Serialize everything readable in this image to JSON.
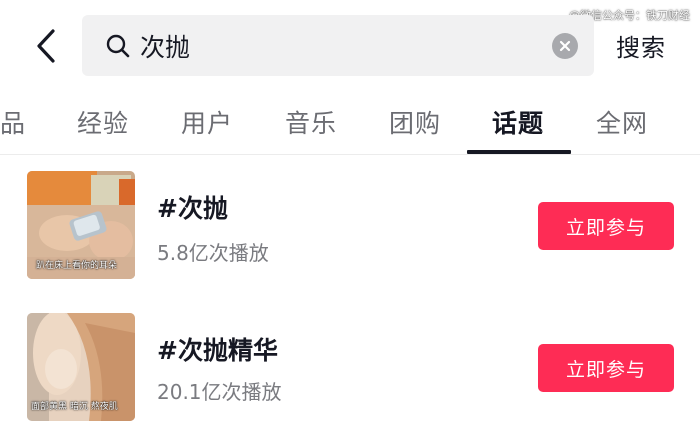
{
  "watermark": "@微信公众号：铁刀财经",
  "search": {
    "query": "次抛",
    "action_label": "搜索"
  },
  "tabs": [
    {
      "label": "品"
    },
    {
      "label": "经验"
    },
    {
      "label": "用户"
    },
    {
      "label": "音乐"
    },
    {
      "label": "团购"
    },
    {
      "label": "话题",
      "active": true
    },
    {
      "label": "全网"
    }
  ],
  "topics": [
    {
      "name": "#次抛",
      "plays": "5.8亿次播放",
      "button_label": "立即参与",
      "thumb_caption": "趴在床上看你的耳朵"
    },
    {
      "name": "#次抛精华",
      "plays": "20.1亿次播放",
      "button_label": "立即参与",
      "thumb_caption": "面部黄黑 暗沉 熬夜肌"
    }
  ],
  "colors": {
    "accent": "#fe2c55",
    "search_bg": "#f1f1f2",
    "text_primary": "#161823",
    "text_secondary": "#7a7b80"
  }
}
